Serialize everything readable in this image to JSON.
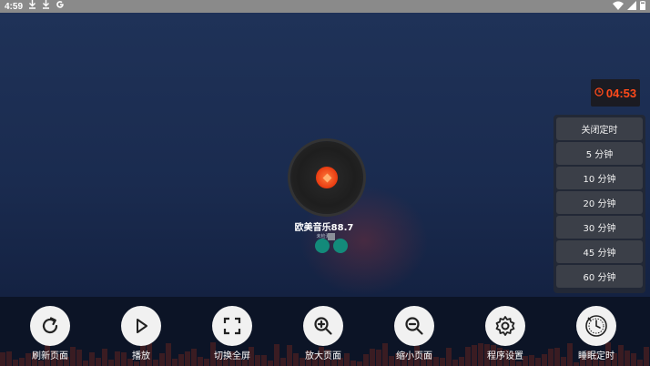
{
  "status_bar": {
    "time": "4:59",
    "left_icons": [
      "download-icon",
      "download-icon",
      "google-icon"
    ],
    "right_icons": [
      "wifi-icon",
      "signal-icon",
      "battery-icon"
    ]
  },
  "timer": {
    "value": "04:53",
    "color": "#ff4a1a"
  },
  "sleep_menu": {
    "items": [
      "关闭定时",
      "5 分钟",
      "10 分钟",
      "20 分钟",
      "30 分钟",
      "45 分钟",
      "60 分钟"
    ]
  },
  "player": {
    "station_name": "欧美音乐88.7",
    "station_sub": "未检测"
  },
  "controls": [
    {
      "label": "刷新页面",
      "icon": "refresh-icon"
    },
    {
      "label": "播放",
      "icon": "play-icon"
    },
    {
      "label": "切换全屏",
      "icon": "fullscreen-icon"
    },
    {
      "label": "放大页面",
      "icon": "zoom-in-icon"
    },
    {
      "label": "缩小页面",
      "icon": "zoom-out-icon"
    },
    {
      "label": "程序设置",
      "icon": "gear-icon"
    },
    {
      "label": "睡眠定时",
      "icon": "sleep-timer-icon"
    }
  ]
}
